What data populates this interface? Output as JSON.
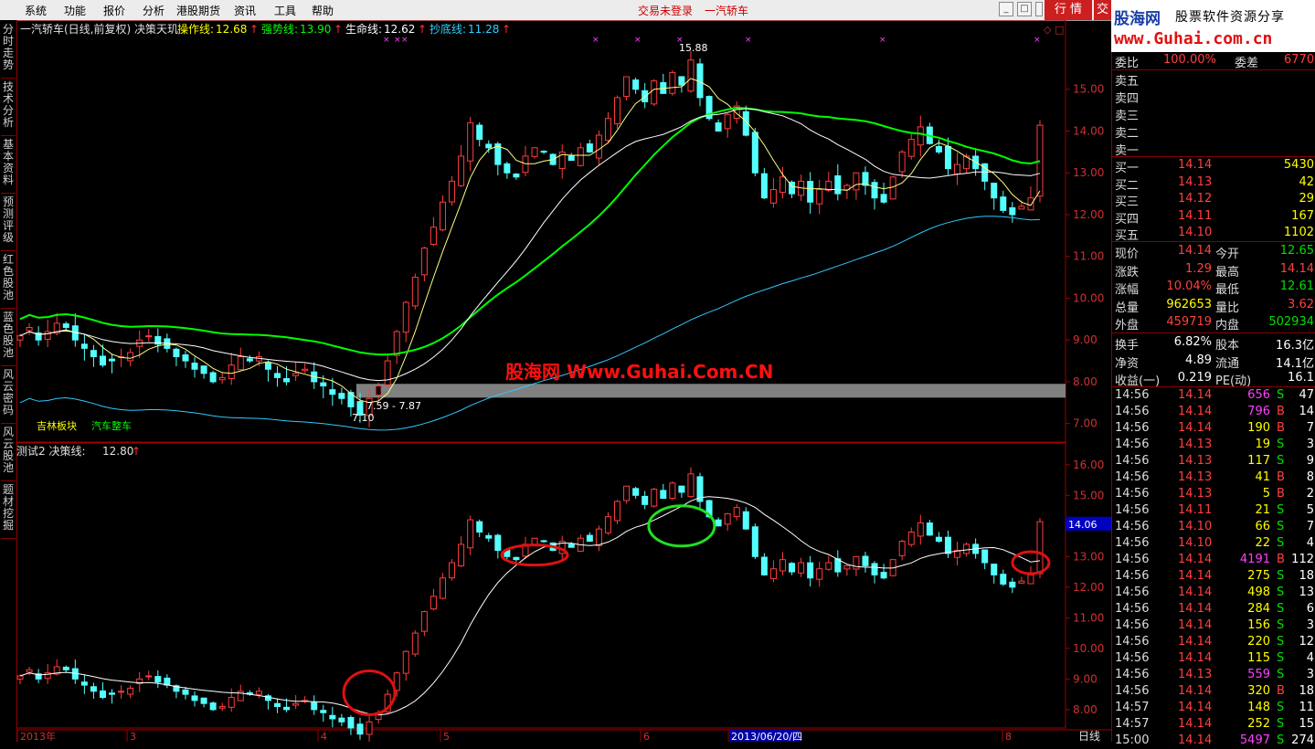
{
  "menu": [
    "系统",
    "功能",
    "报价",
    "分析",
    "港股期货",
    "资讯",
    "工具",
    "帮助"
  ],
  "title_status": "交易未登录",
  "title_stock": "一汽轿车",
  "tabs": [
    "行 情",
    "交"
  ],
  "logo": {
    "name": "股海网",
    "slogan": "股票软件资源分享",
    "url": "www.Guhai.com.cn"
  },
  "left_tabs": [
    "分时走势",
    "技术分析",
    "基本资料",
    "预测评级",
    "红色股池",
    "蓝色股池",
    "风云密码",
    "风云股池",
    "题材挖掘"
  ],
  "upper": {
    "title": "一汽轿车(日线,前复权) 决策天玑",
    "indicators": [
      {
        "label": "操作线:",
        "value": "12.68",
        "color": "#ffff00"
      },
      {
        "label": "强势线:",
        "value": "13.90",
        "color": "#00ff00"
      },
      {
        "label": "生命线:",
        "value": "12.62",
        "color": "#ffffff"
      },
      {
        "label": "抄底线:",
        "value": "11.28",
        "color": "#30d0ff"
      }
    ],
    "yticks": [
      "15.00",
      "14.00",
      "13.00",
      "12.00",
      "11.00",
      "10.00",
      "9.00",
      "8.00",
      "7.00"
    ],
    "high_label": "15.88",
    "low_label": "7.10",
    "zone_label": "7.59 - 7.87",
    "tags": [
      "吉林板块",
      "汽车整车"
    ],
    "watermark": "股海网 Www.Guhai.Com.CN"
  },
  "lower": {
    "title": "测试2 决策线:",
    "value": "12.80",
    "yticks": [
      "16.00",
      "15.00",
      "14.00",
      "13.00",
      "12.00",
      "11.00",
      "10.00",
      "9.00",
      "8.00"
    ],
    "price_marker": "14.06"
  },
  "xaxis": {
    "labels": [
      "2013年",
      "3",
      "4",
      "5",
      "6",
      "2013/06/20/四",
      "8"
    ],
    "period": "日线"
  },
  "quote": {
    "ratio_label": "委比",
    "ratio_value": "100.00%",
    "diff_label": "委差",
    "diff_value": "6770",
    "sells": [
      {
        "label": "卖五"
      },
      {
        "label": "卖四"
      },
      {
        "label": "卖三"
      },
      {
        "label": "卖二"
      },
      {
        "label": "卖一"
      }
    ],
    "buys": [
      {
        "label": "买一",
        "price": "14.14",
        "vol": "5430"
      },
      {
        "label": "买二",
        "price": "14.13",
        "vol": "42"
      },
      {
        "label": "买三",
        "price": "14.12",
        "vol": "29"
      },
      {
        "label": "买四",
        "price": "14.11",
        "vol": "167"
      },
      {
        "label": "买五",
        "price": "14.10",
        "vol": "1102"
      }
    ],
    "stats": [
      {
        "l1": "现价",
        "v1": "14.14",
        "l2": "今开",
        "v2": "12.65",
        "c1": "red",
        "c2": "green"
      },
      {
        "l1": "涨跌",
        "v1": "1.29",
        "l2": "最高",
        "v2": "14.14",
        "c1": "red",
        "c2": "red"
      },
      {
        "l1": "涨幅",
        "v1": "10.04%",
        "l2": "最低",
        "v2": "12.61",
        "c1": "red",
        "c2": "green"
      },
      {
        "l1": "总量",
        "v1": "962653",
        "l2": "量比",
        "v2": "3.62",
        "c1": "yellow",
        "c2": "red"
      },
      {
        "l1": "外盘",
        "v1": "459719",
        "l2": "内盘",
        "v2": "502934",
        "c1": "red",
        "c2": "green"
      },
      {
        "l1": "换手",
        "v1": "6.82%",
        "l2": "股本",
        "v2": "16.3亿",
        "c1": "white",
        "c2": "white"
      },
      {
        "l1": "净资",
        "v1": "4.89",
        "l2": "流通",
        "v2": "14.1亿",
        "c1": "white",
        "c2": "white"
      },
      {
        "l1": "收益(一)",
        "v1": "0.219",
        "l2": "PE(动)",
        "v2": "16.1",
        "c1": "white",
        "c2": "white"
      }
    ],
    "ticks": [
      {
        "t": "14:56",
        "p": "14.14",
        "v": "656",
        "bs": "S",
        "n": "47",
        "vc": "magenta"
      },
      {
        "t": "14:56",
        "p": "14.14",
        "v": "796",
        "bs": "B",
        "n": "14",
        "vc": "magenta"
      },
      {
        "t": "14:56",
        "p": "14.14",
        "v": "190",
        "bs": "B",
        "n": "7",
        "vc": "yellow"
      },
      {
        "t": "14:56",
        "p": "14.13",
        "v": "19",
        "bs": "S",
        "n": "3",
        "vc": "yellow"
      },
      {
        "t": "14:56",
        "p": "14.13",
        "v": "117",
        "bs": "S",
        "n": "9",
        "vc": "yellow"
      },
      {
        "t": "14:56",
        "p": "14.13",
        "v": "41",
        "bs": "B",
        "n": "8",
        "vc": "yellow"
      },
      {
        "t": "14:56",
        "p": "14.13",
        "v": "5",
        "bs": "B",
        "n": "2",
        "vc": "yellow"
      },
      {
        "t": "14:56",
        "p": "14.11",
        "v": "21",
        "bs": "S",
        "n": "5",
        "vc": "yellow"
      },
      {
        "t": "14:56",
        "p": "14.10",
        "v": "66",
        "bs": "S",
        "n": "7",
        "vc": "yellow"
      },
      {
        "t": "14:56",
        "p": "14.10",
        "v": "22",
        "bs": "S",
        "n": "4",
        "vc": "yellow"
      },
      {
        "t": "14:56",
        "p": "14.14",
        "v": "4191",
        "bs": "B",
        "n": "112",
        "vc": "magenta"
      },
      {
        "t": "14:56",
        "p": "14.14",
        "v": "275",
        "bs": "S",
        "n": "18",
        "vc": "yellow"
      },
      {
        "t": "14:56",
        "p": "14.14",
        "v": "498",
        "bs": "S",
        "n": "13",
        "vc": "yellow"
      },
      {
        "t": "14:56",
        "p": "14.14",
        "v": "284",
        "bs": "S",
        "n": "6",
        "vc": "yellow"
      },
      {
        "t": "14:56",
        "p": "14.14",
        "v": "156",
        "bs": "S",
        "n": "3",
        "vc": "yellow"
      },
      {
        "t": "14:56",
        "p": "14.14",
        "v": "220",
        "bs": "S",
        "n": "12",
        "vc": "yellow"
      },
      {
        "t": "14:56",
        "p": "14.14",
        "v": "115",
        "bs": "S",
        "n": "4",
        "vc": "yellow"
      },
      {
        "t": "14:56",
        "p": "14.13",
        "v": "559",
        "bs": "S",
        "n": "3",
        "vc": "magenta"
      },
      {
        "t": "14:56",
        "p": "14.14",
        "v": "320",
        "bs": "B",
        "n": "18",
        "vc": "yellow"
      },
      {
        "t": "14:57",
        "p": "14.14",
        "v": "148",
        "bs": "S",
        "n": "11",
        "vc": "yellow"
      },
      {
        "t": "14:57",
        "p": "14.14",
        "v": "252",
        "bs": "S",
        "n": "15",
        "vc": "yellow"
      },
      {
        "t": "15:00",
        "p": "14.14",
        "v": "5497",
        "bs": "S",
        "n": "274",
        "vc": "magenta"
      }
    ]
  },
  "chart_data": {
    "type": "candlestick",
    "note_series": [
      "操作线",
      "强势线",
      "生命线",
      "抄底线",
      "决策线"
    ],
    "closes": [
      9.1,
      9.3,
      9.0,
      9.2,
      9.4,
      9.3,
      9.0,
      8.8,
      8.6,
      8.4,
      8.5,
      8.6,
      8.7,
      9.0,
      9.1,
      8.9,
      8.8,
      8.6,
      8.5,
      8.3,
      8.2,
      8.0,
      8.1,
      8.4,
      8.6,
      8.5,
      8.6,
      8.3,
      8.1,
      8.0,
      8.2,
      8.3,
      8.0,
      7.9,
      7.7,
      7.6,
      7.4,
      7.2,
      7.6,
      7.9,
      8.5,
      9.2,
      9.9,
      10.5,
      11.2,
      11.7,
      12.3,
      12.8,
      13.4,
      14.2,
      13.8,
      13.6,
      13.2,
      13.0,
      12.9,
      13.4,
      13.6,
      13.5,
      13.2,
      13.5,
      13.3,
      13.6,
      13.5,
      13.9,
      14.3,
      14.8,
      15.3,
      15.0,
      14.7,
      15.2,
      14.9,
      15.4,
      15.1,
      15.7,
      14.8,
      14.3,
      14.0,
      14.4,
      14.6,
      13.9,
      13.0,
      12.4,
      12.6,
      12.9,
      12.5,
      12.8,
      12.3,
      12.6,
      12.8,
      12.5,
      12.7,
      13.0,
      12.7,
      12.4,
      12.3,
      12.9,
      13.5,
      13.8,
      14.1,
      13.7,
      13.5,
      13.1,
      13.2,
      13.4,
      13.1,
      12.8,
      12.4,
      12.1,
      12.0,
      12.2,
      12.4,
      14.14
    ]
  }
}
